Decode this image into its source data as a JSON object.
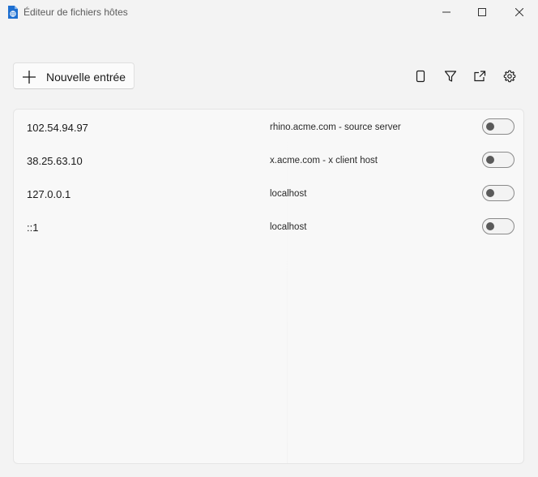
{
  "window": {
    "title": "Éditeur de fichiers hôtes",
    "icon": "document-globe-icon",
    "accent": "#0067c0"
  },
  "toolbar": {
    "add_label": "Nouvelle entrée",
    "icons": [
      "phone-icon",
      "filter-icon",
      "open-external-icon",
      "gear-icon"
    ]
  },
  "entries": [
    {
      "address": "102.54.94.97",
      "host": "rhino.acme.com - source server",
      "enabled": false
    },
    {
      "address": "38.25.63.10",
      "host": "x.acme.com - x client host",
      "enabled": false
    },
    {
      "address": "127.0.0.1",
      "host": "localhost",
      "enabled": false
    },
    {
      "address": "::1",
      "host": "localhost",
      "enabled": false
    }
  ]
}
